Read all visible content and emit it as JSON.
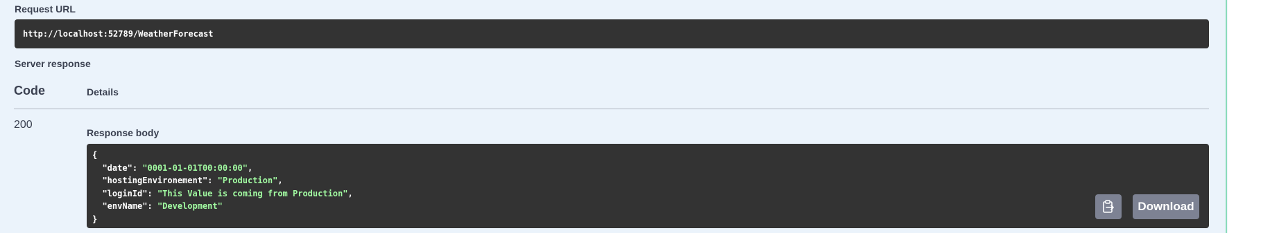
{
  "request_url": {
    "label": "Request URL",
    "value": "http://localhost:52789/WeatherForecast"
  },
  "server_response": {
    "label": "Server response",
    "columns": {
      "code": "Code",
      "details": "Details"
    },
    "status_code": "200",
    "response_body_label": "Response body",
    "body_lines": {
      "open": "{",
      "date_key": "\"date\"",
      "date_val": "\"0001-01-01T00:00:00\"",
      "hosting_key": "\"hostingEnvironement\"",
      "hosting_val": "\"Production\"",
      "login_key": "\"loginId\"",
      "login_val": "\"This Value is coming from Production\"",
      "env_key": "\"envName\"",
      "env_val": "\"Development\"",
      "close": "}"
    },
    "buttons": {
      "copy_icon": "clipboard-icon",
      "download_label": "Download"
    }
  },
  "colors": {
    "panel_bg": "#ebf3fb",
    "code_bg": "#333333",
    "json_string": "#a2fca2",
    "button_bg": "#7d8293",
    "text": "#3b4151"
  }
}
